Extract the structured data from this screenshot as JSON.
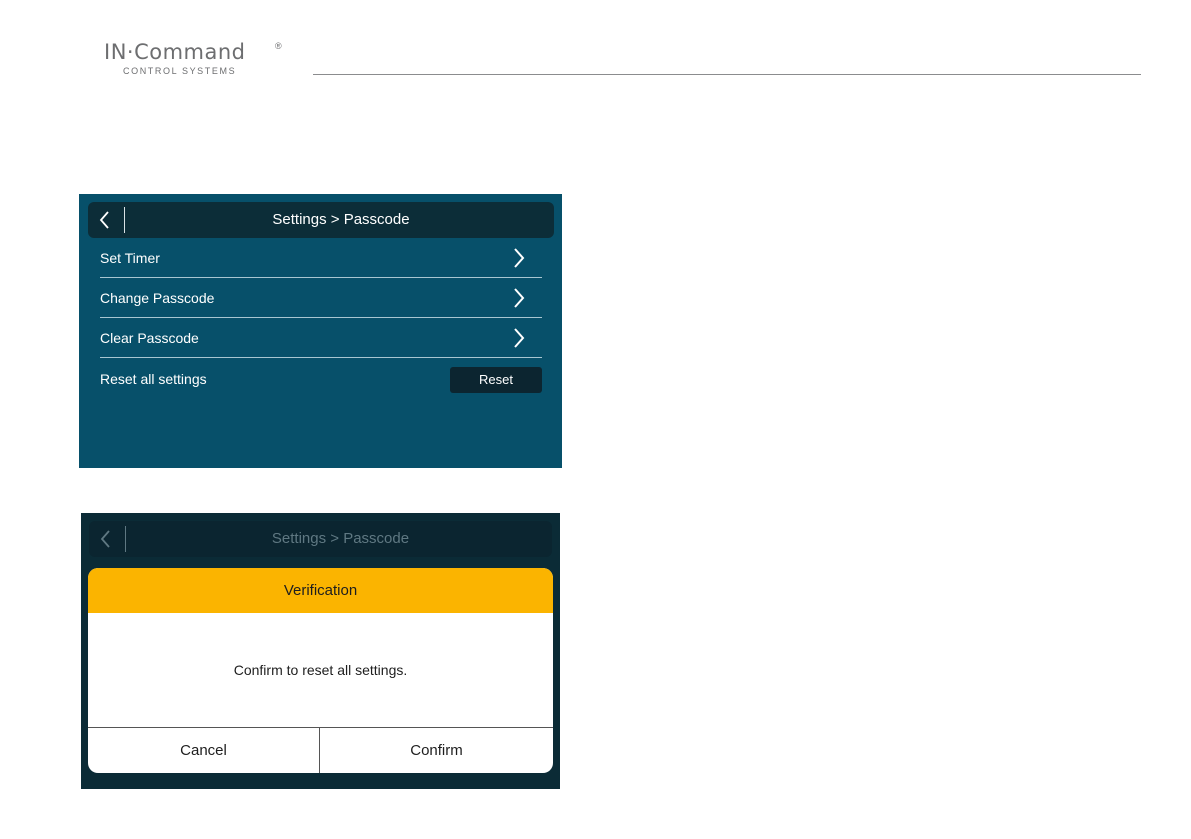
{
  "brand": {
    "name": "IN·Command",
    "registered": "®",
    "tagline": "CONTROL SYSTEMS"
  },
  "screen1": {
    "title": "Settings > Passcode",
    "back_icon": "chevron-left-icon",
    "rows": [
      {
        "label": "Set Timer",
        "icon": "chevron-right-icon"
      },
      {
        "label": "Change Passcode",
        "icon": "chevron-right-icon"
      },
      {
        "label": "Clear Passcode",
        "icon": "chevron-right-icon"
      },
      {
        "label": "Reset all settings",
        "button": "Reset"
      }
    ]
  },
  "screen2": {
    "title": "Settings > Passcode",
    "back_icon": "chevron-left-icon",
    "dialog": {
      "title": "Verification",
      "message": "Confirm to reset all settings.",
      "cancel": "Cancel",
      "confirm": "Confirm"
    }
  },
  "colors": {
    "screen_bg": "#07506a",
    "dark_bar": "#0c2d38",
    "dialog_header": "#fbb400",
    "logo_gray": "#6d6e70"
  }
}
